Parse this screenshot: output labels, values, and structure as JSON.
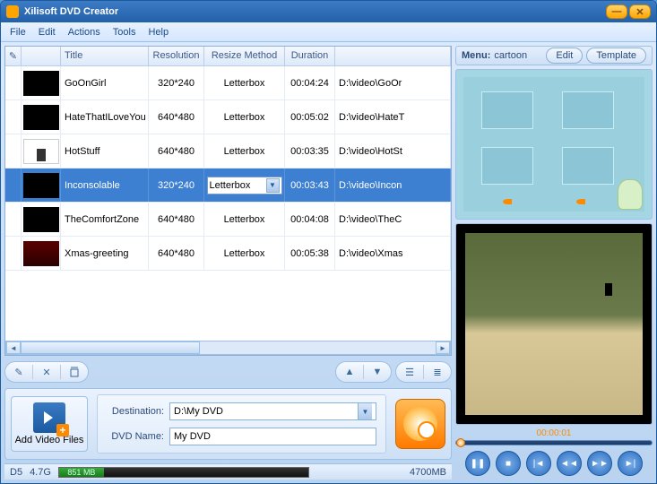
{
  "titlebar": {
    "title": "Xilisoft DVD Creator"
  },
  "menubar": [
    "File",
    "Edit",
    "Actions",
    "Tools",
    "Help"
  ],
  "grid": {
    "headers": {
      "title": "Title",
      "resolution": "Resolution",
      "resize": "Resize Method",
      "duration": "Duration"
    },
    "rows": [
      {
        "title": "GoOnGirl",
        "resolution": "320*240",
        "resize": "Letterbox",
        "duration": "00:04:24",
        "path": "D:\\video\\GoOr"
      },
      {
        "title": "HateThatILoveYou",
        "resolution": "640*480",
        "resize": "Letterbox",
        "duration": "00:05:02",
        "path": "D:\\video\\HateT"
      },
      {
        "title": "HotStuff",
        "resolution": "640*480",
        "resize": "Letterbox",
        "duration": "00:03:35",
        "path": "D:\\video\\HotSt"
      },
      {
        "title": "Inconsolable",
        "resolution": "320*240",
        "resize": "Letterbox",
        "duration": "00:03:43",
        "path": "D:\\video\\Incon",
        "selected": true
      },
      {
        "title": "TheComfortZone",
        "resolution": "640*480",
        "resize": "Letterbox",
        "duration": "00:04:08",
        "path": "D:\\video\\TheC"
      },
      {
        "title": "Xmas-greeting",
        "resolution": "640*480",
        "resize": "Letterbox",
        "duration": "00:05:38",
        "path": "D:\\video\\Xmas"
      }
    ]
  },
  "add_files_label": "Add Video Files",
  "dest": {
    "label": "Destination:",
    "value": "D:\\My DVD"
  },
  "dvdname": {
    "label": "DVD Name:",
    "value": "My DVD"
  },
  "status": {
    "disc_type": "D5",
    "disc_size": "4.7G",
    "used": "851 MB",
    "total": "4700MB"
  },
  "menu_panel": {
    "label": "Menu:",
    "name": "cartoon",
    "edit": "Edit",
    "template": "Template"
  },
  "player": {
    "time": "00:00:01"
  }
}
